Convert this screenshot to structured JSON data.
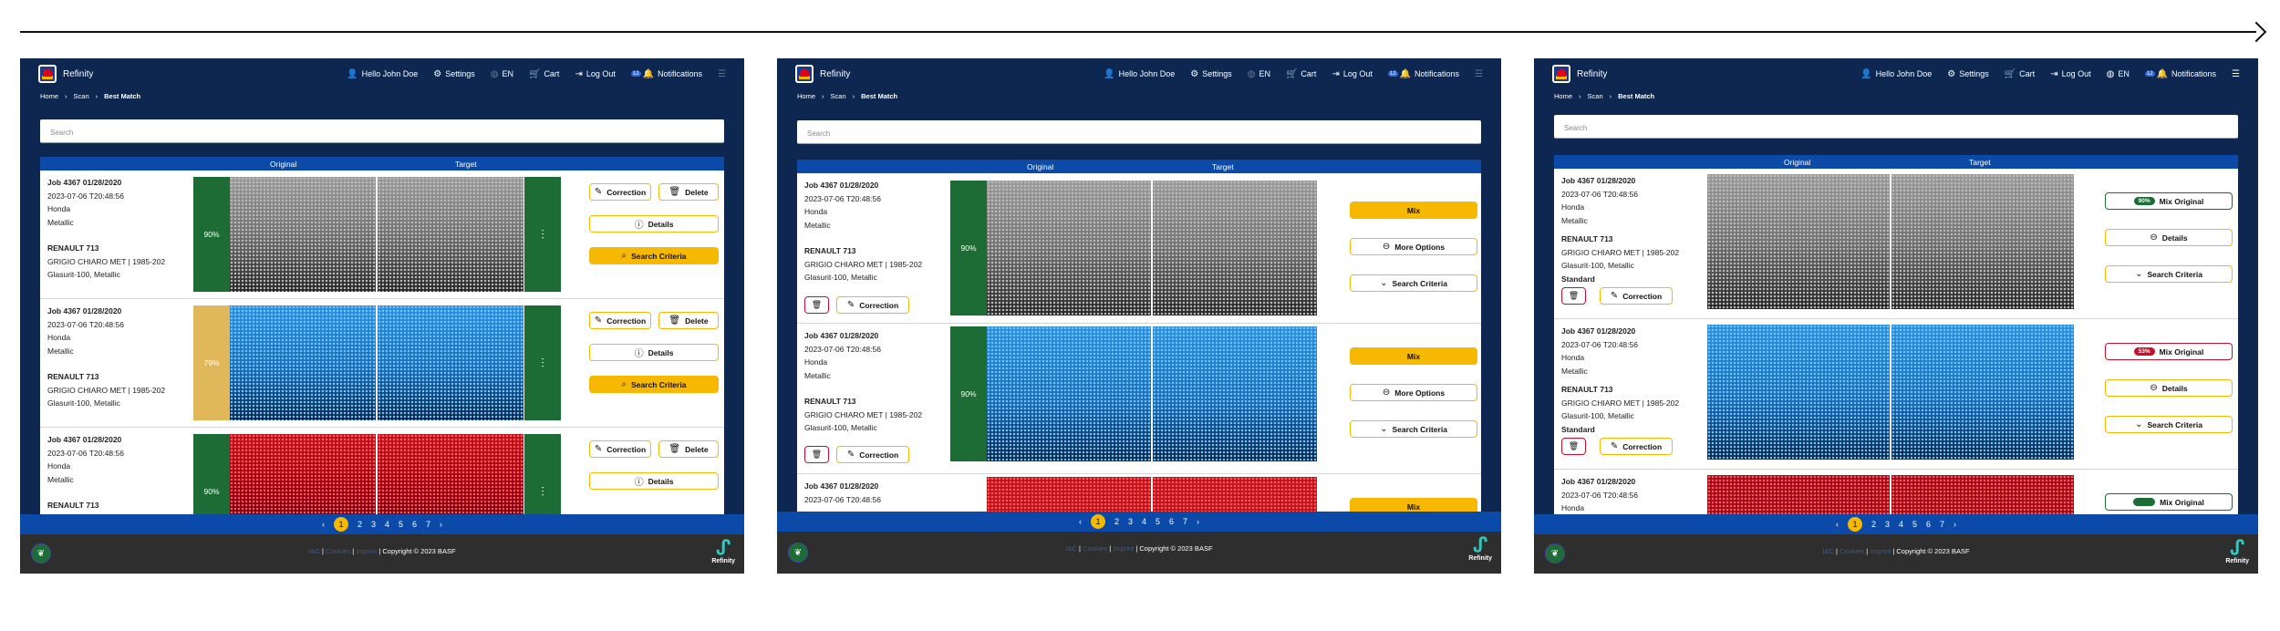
{
  "app": {
    "brand": "Refinity",
    "greeting": "Hello John Doe",
    "settings": "Settings",
    "lang": "EN",
    "cart": "Cart",
    "logout": "Log Out",
    "notifications": "Notifications",
    "notif_count": "12"
  },
  "breadcrumb": {
    "home": "Home",
    "scan": "Scan",
    "current": "Best Match"
  },
  "search": {
    "placeholder": "Search"
  },
  "columns": {
    "original": "Original",
    "target": "Target"
  },
  "job": {
    "title": "Job 4367  01/28/2020",
    "timestamp": "2023-07-06 T20:48:56",
    "make": "Honda",
    "finish": "Metallic",
    "color_code": "RENAULT 713",
    "color_name": "GRIGIO CHIARO MET | 1985-202",
    "product": "Glasurit-100, Metallic",
    "standard": "Standard"
  },
  "actions": {
    "correction": "Correction",
    "delete": "Delete",
    "details": "Details",
    "search_criteria": "Search Criteria",
    "mix": "Mix",
    "more_options": "More Options",
    "mix_original": "Mix Original"
  },
  "screen1": {
    "matches": [
      "90%",
      "79%",
      "90%"
    ]
  },
  "screen2": {
    "matches": [
      "90%",
      "90%"
    ]
  },
  "screen3": {
    "badges": [
      "90%",
      "53%"
    ]
  },
  "pagination": {
    "pages": [
      "1",
      "2",
      "3",
      "4",
      "5",
      "6",
      "7"
    ],
    "current": "1"
  },
  "footer": {
    "link1": "I&C",
    "link2": "Cookies",
    "link3": "Imprint",
    "copyright": "| Copyright © 2023 BASF",
    "logo_text": "Refinity"
  },
  "colors": {
    "navy": "#0e2750",
    "blue_bar": "#0b4aa8",
    "accent_yellow": "#f6b800",
    "match_green": "#1d6b35",
    "match_amber": "#e0b85a",
    "alert_red": "#c8102e"
  },
  "icons": [
    "user-icon",
    "gear-icon",
    "globe-icon",
    "cart-icon",
    "logout-icon",
    "bell-icon",
    "menu-icon",
    "pencil-icon",
    "trash-icon",
    "info-icon",
    "search-icon",
    "sliders-icon",
    "minus-circle-icon",
    "chevron-down-icon",
    "leaf-icon"
  ]
}
